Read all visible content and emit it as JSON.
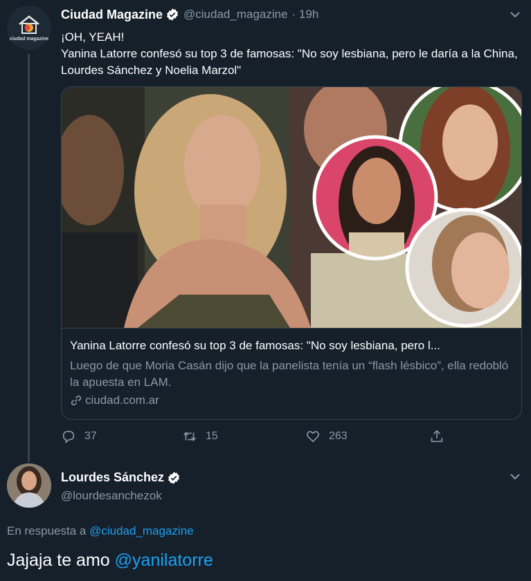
{
  "tweet": {
    "author_name": "Ciudad Magazine",
    "author_handle": "@ciudad_magazine",
    "time": "· 19h",
    "avatar_logo_text": "ciudad magazine",
    "line1": "¡OH, YEAH!",
    "line2": "Yanina Latorre confesó su top 3 de famosas: \"No soy lesbiana, pero le daría a la China, Lourdes Sánchez y Noelia Marzol\"",
    "card": {
      "title": "Yanina Latorre confesó su top 3 de famosas: \"No soy lesbiana, pero l...",
      "description": "Luego de que Moria Casán dijo que la panelista tenía un “flash lésbico”, ella redobló la apuesta en LAM.",
      "domain": "ciudad.com.ar"
    },
    "actions": {
      "replies": "37",
      "retweets": "15",
      "likes": "263"
    }
  },
  "reply": {
    "author_name": "Lourdes Sánchez",
    "author_handle": "@lourdesanchezok",
    "in_reply_prefix": "En respuesta a",
    "in_reply_mention": "@ciudad_magazine",
    "text": "Jajaja te amo",
    "text_mention": "@yanilatorre"
  },
  "colors": {
    "background": "#15202b",
    "accent": "#1da1f2",
    "muted": "#8899a6",
    "border": "#38444d"
  },
  "icons": [
    "house-logo-icon",
    "verified-icon",
    "chevron-down-icon",
    "reply-icon",
    "retweet-icon",
    "like-icon",
    "share-icon",
    "link-icon"
  ]
}
